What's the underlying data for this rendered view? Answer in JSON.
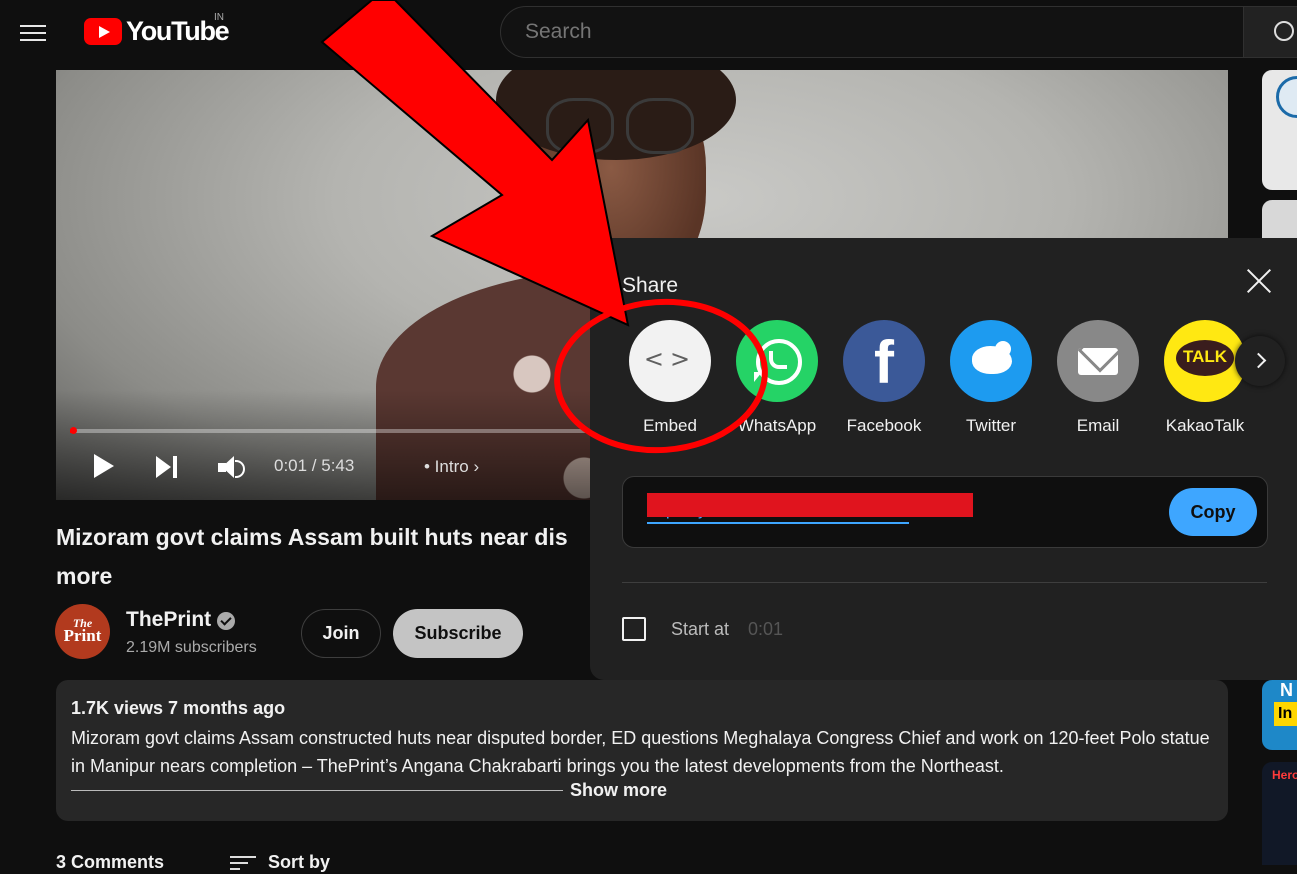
{
  "header": {
    "logo_text": "YouTube",
    "country_code": "IN",
    "search_placeholder": "Search"
  },
  "player": {
    "time": "0:01 / 5:43",
    "chapter": "• Intro",
    "progress": 0.003
  },
  "video": {
    "title_line1": "Mizoram govt claims Assam built huts near dis",
    "title_line2": "more"
  },
  "channel": {
    "avatar_top": "The",
    "avatar_bottom": "Print",
    "name": "ThePrint",
    "subscribers": "2.19M subscribers",
    "join_label": "Join",
    "subscribe_label": "Subscribe"
  },
  "description": {
    "meta": "1.7K views  7 months ago",
    "text": "Mizoram govt claims Assam constructed huts near disputed border, ED questions Meghalaya Congress Chief and work on 120-feet Polo statue in Manipur nears completion – ThePrint’s Angana Chakrabarti brings you the latest developments from the Northeast.",
    "show_more": "Show more"
  },
  "comments": {
    "count_label": "3 Comments",
    "sort_label": "Sort by"
  },
  "sidebar": {
    "thumb3_top": "N",
    "thumb3_badge": "In",
    "thumb4_label": "Hero"
  },
  "share": {
    "title": "Share",
    "targets": [
      {
        "label": "Embed",
        "icon": "embed-icon"
      },
      {
        "label": "WhatsApp",
        "icon": "whatsapp-icon"
      },
      {
        "label": "Facebook",
        "icon": "facebook-icon"
      },
      {
        "label": "Twitter",
        "icon": "twitter-icon"
      },
      {
        "label": "Email",
        "icon": "email-icon"
      },
      {
        "label": "KakaoTalk",
        "icon": "kakaotalk-icon"
      }
    ],
    "facebook_glyph": "f",
    "kakao_glyph": "TALK",
    "embed_glyph": "<>",
    "link_url": "https://youtu.be/",
    "copy_label": "Copy",
    "start_at_label": "Start at",
    "start_at_value": "0:01"
  },
  "colors": {
    "accent_blue": "#3ea6ff",
    "brand_red": "#ff0000",
    "annotation_red": "#ff0000"
  }
}
